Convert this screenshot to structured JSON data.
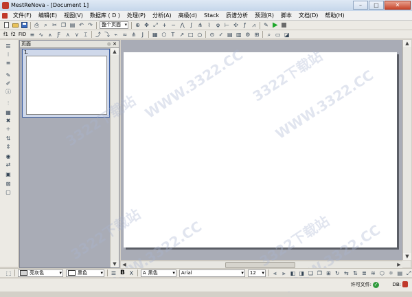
{
  "window": {
    "title": "MestReNova - [Document 1]"
  },
  "menu": [
    "文件(F)",
    "编辑(E)",
    "视图(V)",
    "数据库 ( D )",
    "处理(P)",
    "分析(A)",
    "高级(d)",
    "Stack",
    "质谱分析",
    "预测(R)",
    "脚本",
    "文档(D)",
    "帮助(H)"
  ],
  "toolbar1": {
    "page_combo": "整个页面"
  },
  "toolbar2": {
    "f1_label": "f1",
    "f2_label": "f2",
    "fid_label": "FID"
  },
  "pages_panel": {
    "title": "页面",
    "thumb_number": "1."
  },
  "bottom_bar": {
    "fill_color": "亮灰色",
    "line_color": "黑色",
    "font_color": "黑色",
    "font_name": "Arial",
    "font_size": "12",
    "bold": "B",
    "subscript": "X"
  },
  "status": {
    "license_label": "许可文件:",
    "db_label": "DB:"
  },
  "watermark": {
    "text1": "3322下载站",
    "text2": "WWW.3322.CC"
  },
  "colors": {
    "accent": "#c0392b",
    "doc_background": "#a9acb6",
    "license_ok": "#2e9a3a"
  }
}
